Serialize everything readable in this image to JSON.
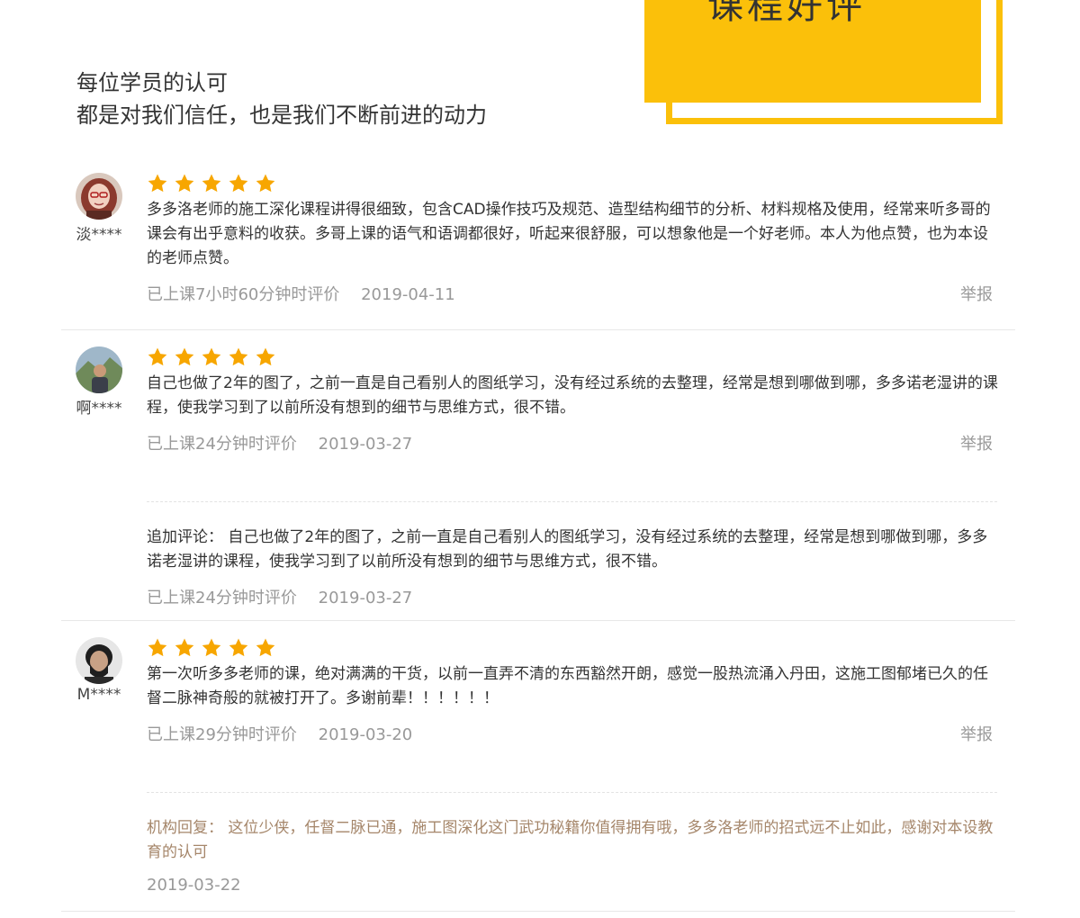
{
  "header": {
    "badge_title": "课程好评",
    "subtitle_line1": "每位学员的认可",
    "subtitle_line2": "都是对我们信任，也是我们不断前进的动力"
  },
  "colors": {
    "accent": "#fbc00a",
    "star": "#f7a600",
    "reply": "#a5866a",
    "meta": "#999999"
  },
  "reviews": [
    {
      "user": "淡****",
      "rating": 5,
      "text": "多多洛老师的施工深化课程讲得很细致，包含CAD操作技巧及规范、造型结构细节的分析、材料规格及使用，经常来听多哥的课会有出乎意料的收获。多哥上课的语气和语调都很好，听起来很舒服，可以想象他是一个好老师。本人为他点赞，也为本设的老师点赞。",
      "duration": "已上课7小时60分钟时评价",
      "date": "2019-04-11",
      "report": "举报"
    },
    {
      "user": "啊****",
      "rating": 5,
      "text": " 自己也做了2年的图了，之前一直是自己看别人的图纸学习，没有经过系统的去整理，经常是想到哪做到哪，多多诺老湿讲的课程，使我学习到了以前所没有想到的细节与思维方式，很不错。",
      "duration": "已上课24分钟时评价",
      "date": "2019-03-27",
      "report": "举报",
      "followup": {
        "text": "追加评论： 自己也做了2年的图了，之前一直是自己看别人的图纸学习，没有经过系统的去整理，经常是想到哪做到哪，多多诺老湿讲的课程，使我学习到了以前所没有想到的细节与思维方式，很不错。",
        "duration": "已上课24分钟时评价",
        "date": "2019-03-27"
      }
    },
    {
      "user": "M****",
      "rating": 5,
      "text": "第一次听多多老师的课，绝对满满的干货，以前一直弄不清的东西豁然开朗，感觉一股热流涌入丹田，这施工图郁堵已久的任督二脉神奇般的就被打开了。多谢前辈！！！！！！",
      "duration": "已上课29分钟时评价",
      "date": "2019-03-20",
      "report": "举报",
      "reply": {
        "text": " 机构回复： 这位少侠，任督二脉已通，施工图深化这门武功秘籍你值得拥有哦，多多洛老师的招式远不止如此，感谢对本设教育的认可",
        "date": "2019-03-22"
      }
    }
  ]
}
